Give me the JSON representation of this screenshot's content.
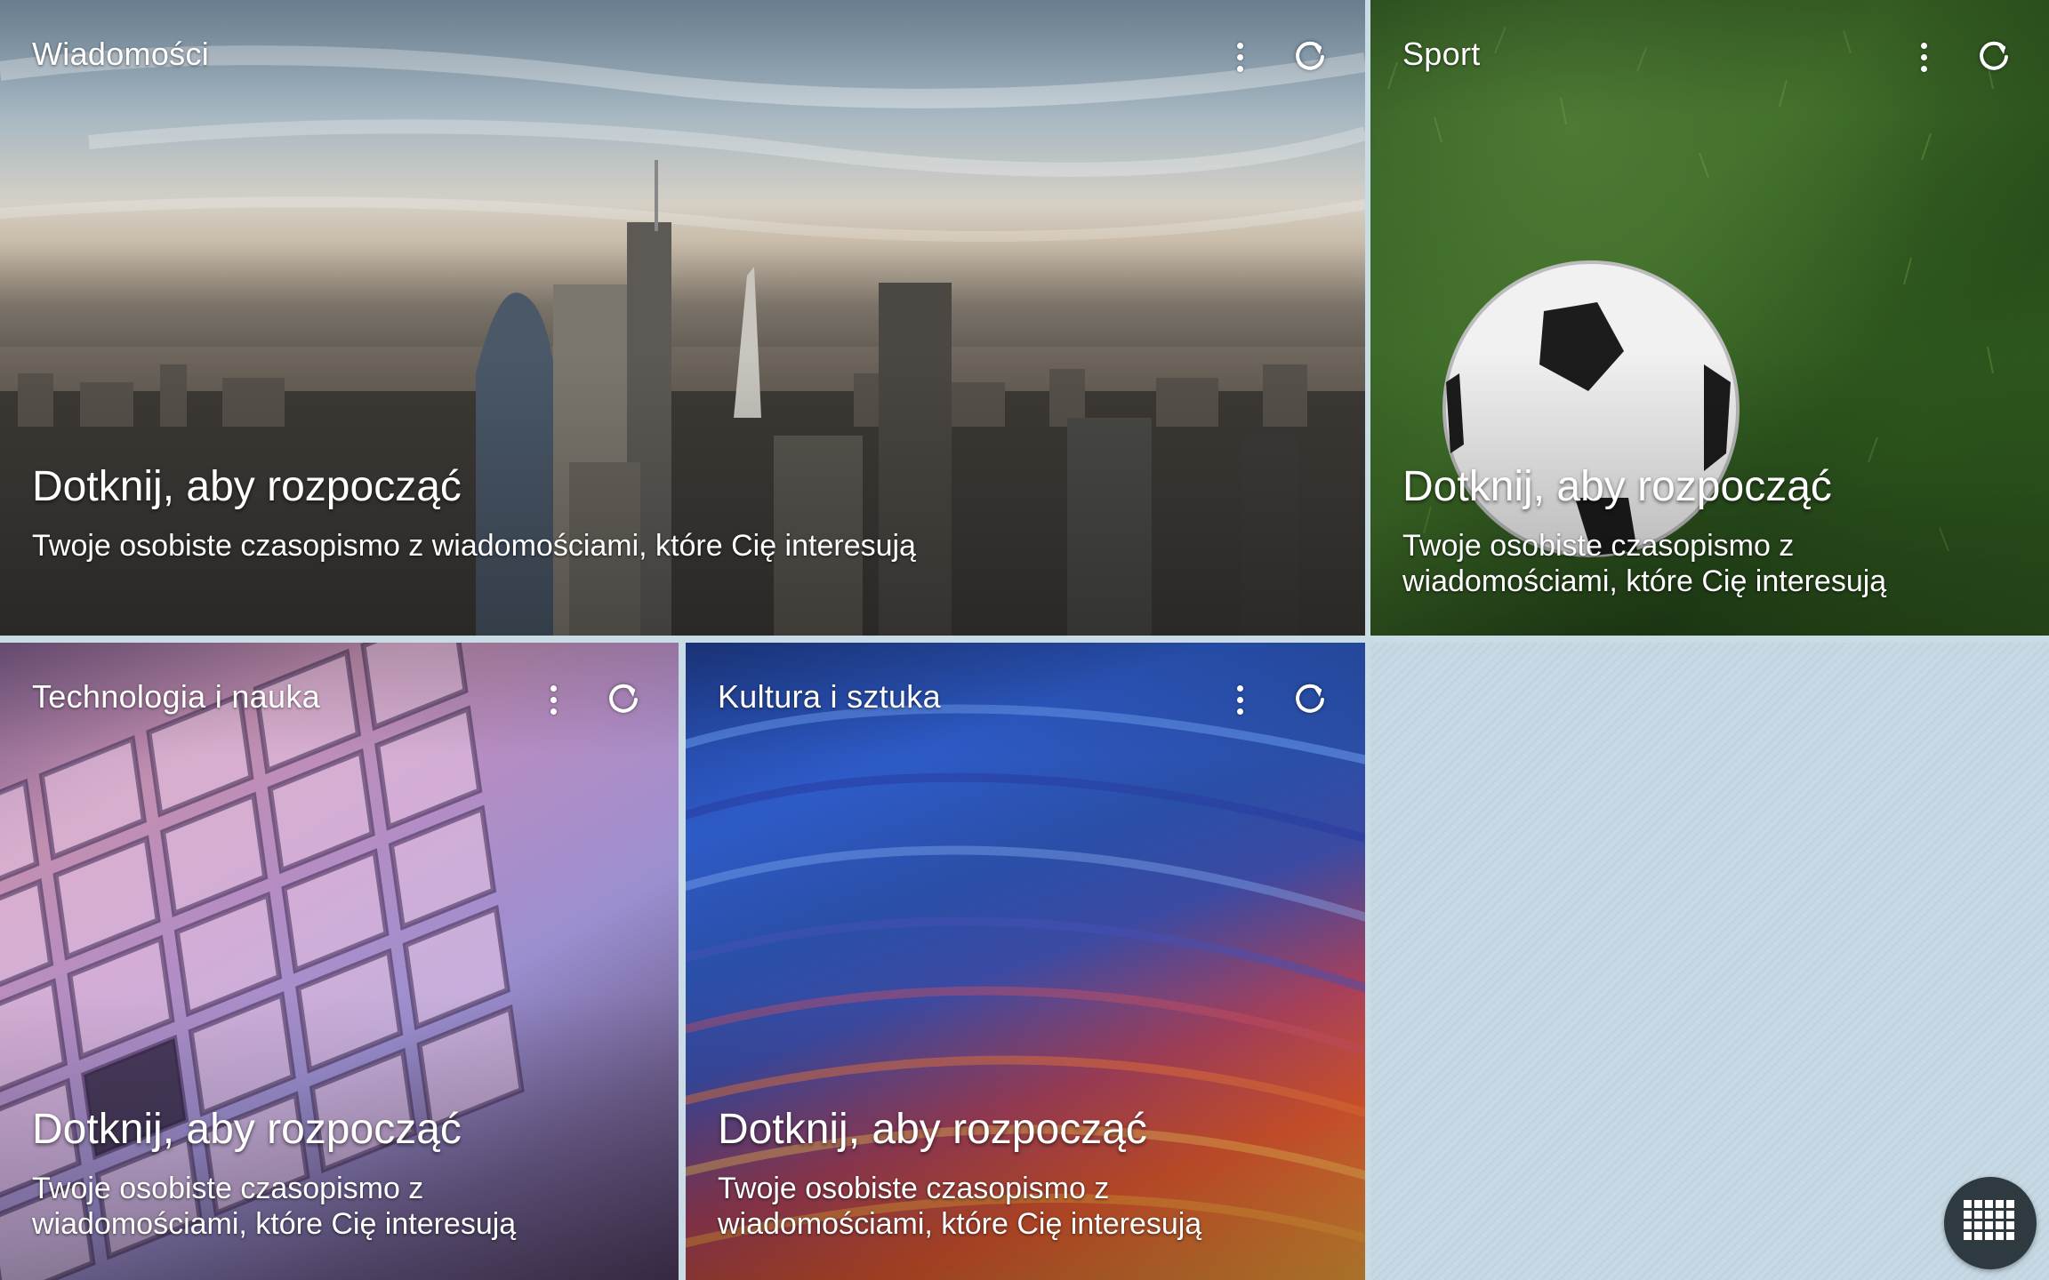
{
  "tiles": {
    "news": {
      "title": "Wiadomości",
      "cta": "Dotknij, aby rozpocząć",
      "description": "Twoje osobiste czasopismo z wiadomościami, które Cię interesują",
      "background_image": "city-skyline"
    },
    "sport": {
      "title": "Sport",
      "cta": "Dotknij, aby rozpocząć",
      "description": "Twoje osobiste czasopismo z wiadomościami, które Cię interesują",
      "background_image": "soccer-ball-on-grass"
    },
    "tech": {
      "title": "Technologia i nauka",
      "cta": "Dotknij, aby rozpocząć",
      "description": "Twoje osobiste czasopismo z wiadomościami, które Cię interesują",
      "background_image": "microchip-wafer"
    },
    "culture": {
      "title": "Kultura i sztuka",
      "cta": "Dotknij, aby rozpocząć",
      "description": "Twoje osobiste czasopismo z wiadomościami, które Cię interesują",
      "background_image": "abstract-painting"
    }
  },
  "icons": {
    "more": "more-vertical-icon",
    "refresh": "refresh-icon",
    "apps": "apps-grid-icon"
  },
  "colors": {
    "text": "#ffffff",
    "empty_background": "#c7d9e4",
    "apps_button": "#2e3a40"
  }
}
